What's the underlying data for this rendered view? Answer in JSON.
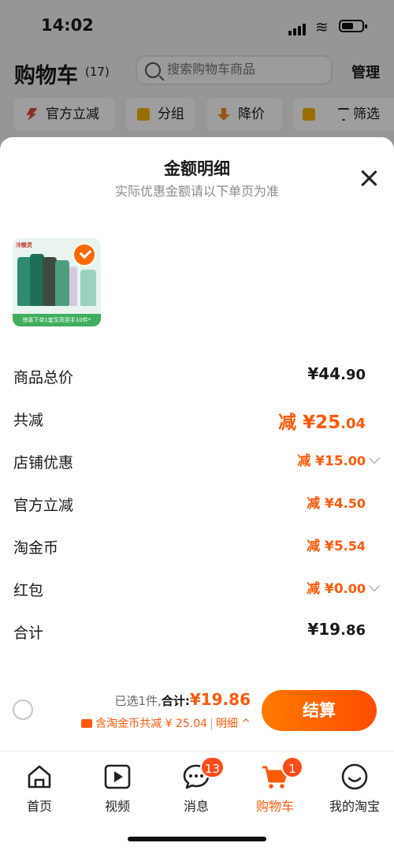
{
  "status_bar": {
    "time": "14:02"
  },
  "header": {
    "title": "购物车",
    "count": "(17)",
    "search_placeholder": "搜索购物车商品",
    "manage_label": "管理"
  },
  "filter_chips": [
    {
      "label": "官方立减",
      "icon": "lightning-icon"
    },
    {
      "label": "分组",
      "icon": "folder-icon"
    },
    {
      "label": "降价",
      "icon": "down-arrow-icon"
    },
    {
      "label": "筛选",
      "icon": "filter-icon"
    }
  ],
  "sheet": {
    "title": "金额明细",
    "subtitle": "实际优惠金额请以下单页为准",
    "product": {
      "brand_text": "冷酸灵",
      "banner_text": "惊喜下单1套至高到手10件*"
    },
    "rows": [
      {
        "label": "商品总价",
        "prefix": "¥",
        "int": "44",
        "dec": ".90",
        "style": "black",
        "chevron": false
      },
      {
        "label": "共减",
        "prefix": "减 ¥",
        "int": "25",
        "dec": ".04",
        "style": "orange-large",
        "chevron": false
      },
      {
        "label": "店铺优惠",
        "prefix": "减 ¥",
        "int": "15",
        "dec": ".00",
        "style": "orange",
        "chevron": true
      },
      {
        "label": "官方立减",
        "prefix": "减 ¥",
        "int": "4",
        "dec": ".50",
        "style": "orange",
        "chevron": false
      },
      {
        "label": "淘金币",
        "prefix": "减 ¥",
        "int": "5",
        "dec": ".54",
        "style": "orange",
        "chevron": false
      },
      {
        "label": "红包",
        "prefix": "减 ¥",
        "int": "0",
        "dec": ".00",
        "style": "orange",
        "chevron": true
      },
      {
        "label": "合计",
        "prefix": "¥",
        "int": "19",
        "dec": ".86",
        "style": "black",
        "chevron": false
      }
    ]
  },
  "checkout": {
    "selected_text": "已选1件,",
    "total_label": "合计:",
    "total_amount": "¥19.86",
    "coin_text": "含淘金币共减 ¥ 25.04",
    "detail_label": "明细",
    "detail_chevron": "^",
    "settle_label": "结算"
  },
  "tabbar": [
    {
      "label": "首页",
      "icon": "home-icon",
      "badge": null,
      "active": false
    },
    {
      "label": "视频",
      "icon": "video-play-icon",
      "badge": null,
      "active": false
    },
    {
      "label": "消息",
      "icon": "message-icon",
      "badge": "13",
      "active": false
    },
    {
      "label": "购物车",
      "icon": "cart-icon",
      "badge": "1",
      "active": true
    },
    {
      "label": "我的淘宝",
      "icon": "smile-icon",
      "badge": null,
      "active": false
    }
  ],
  "colors": {
    "accent": "#ff5a0a",
    "settle_start": "#ff7a00",
    "settle_end": "#ff4d00"
  }
}
